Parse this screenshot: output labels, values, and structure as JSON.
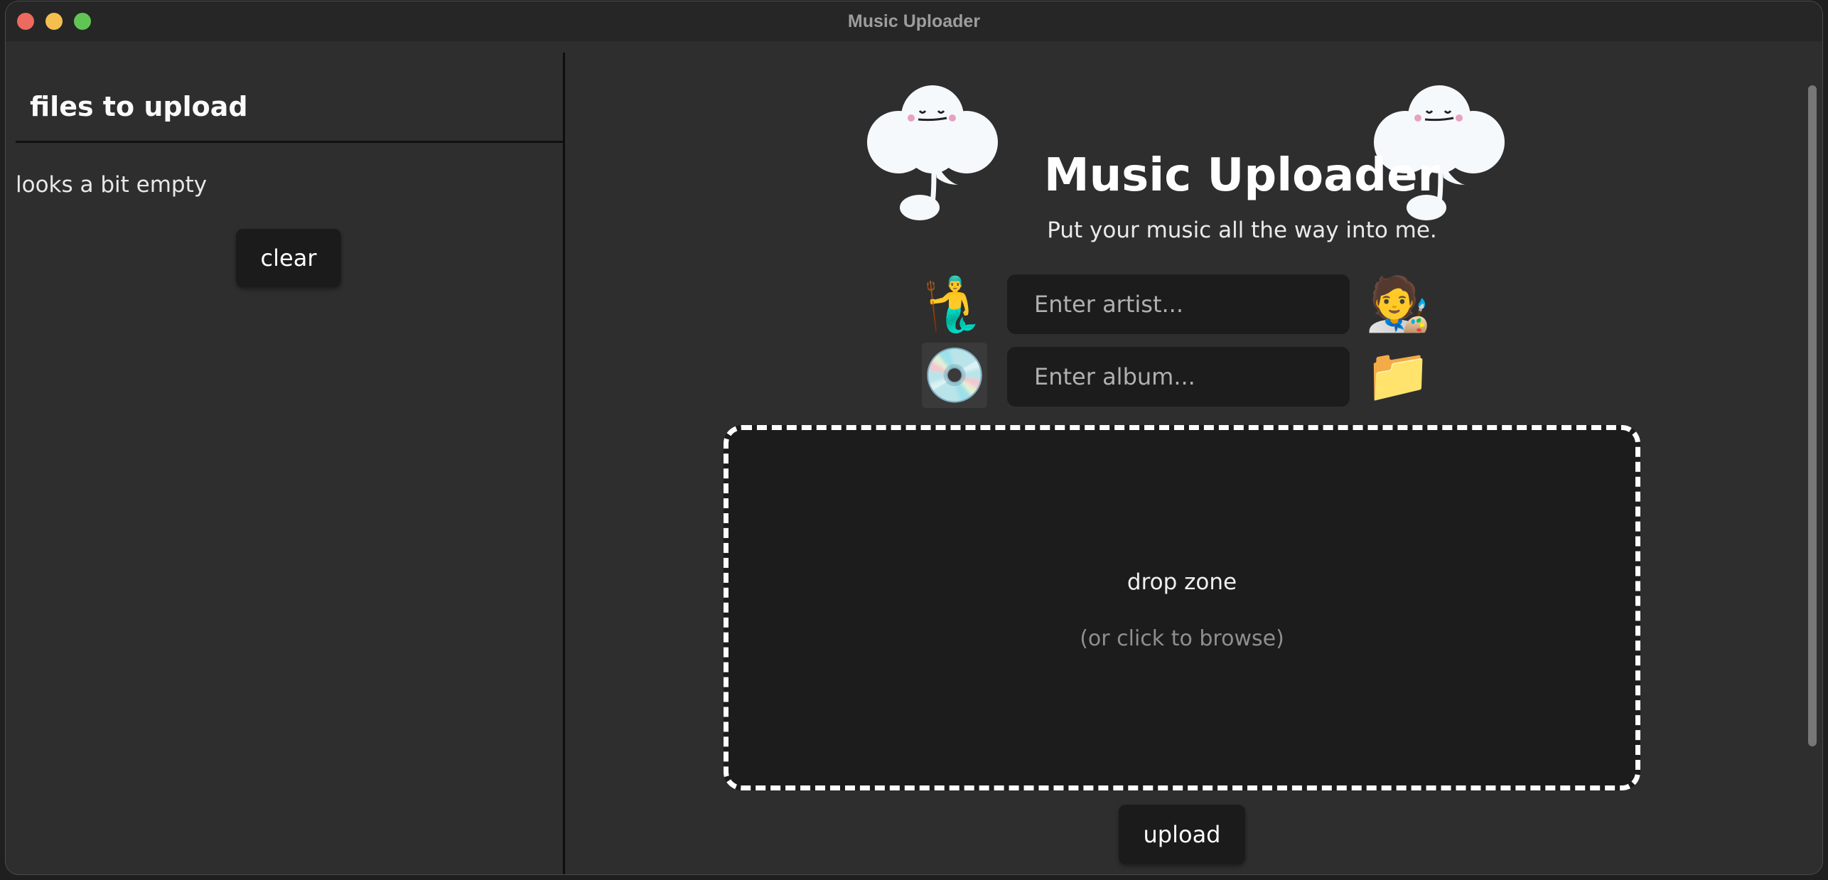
{
  "window": {
    "title": "Music Uploader"
  },
  "sidebar": {
    "title": "files to upload",
    "empty_message": "looks a bit empty",
    "clear_label": "clear"
  },
  "main": {
    "heading": "Music Uploader",
    "tagline": "Put your music all the way into me.",
    "artist_field": {
      "placeholder": "Enter artist...",
      "value": ""
    },
    "album_field": {
      "placeholder": "Enter album...",
      "value": ""
    },
    "emojis": {
      "artist_left": "🧜‍♂️",
      "artist_right": "🧑‍🎨",
      "album_left": "💿",
      "album_right": "📁"
    },
    "drop_zone": {
      "title": "drop zone",
      "subtitle": "(or click to browse)"
    },
    "upload_label": "upload"
  },
  "icons": {
    "mascot": "music-note-cloud-icon",
    "close": "close-icon",
    "minimize": "minimize-icon",
    "maximize": "maximize-icon"
  },
  "colors": {
    "close": "#ec6a5e",
    "minimize": "#f4bf4f",
    "maximize": "#61c554",
    "window_bg": "#2e2e2e",
    "panel_bg": "#1c1c1c"
  }
}
